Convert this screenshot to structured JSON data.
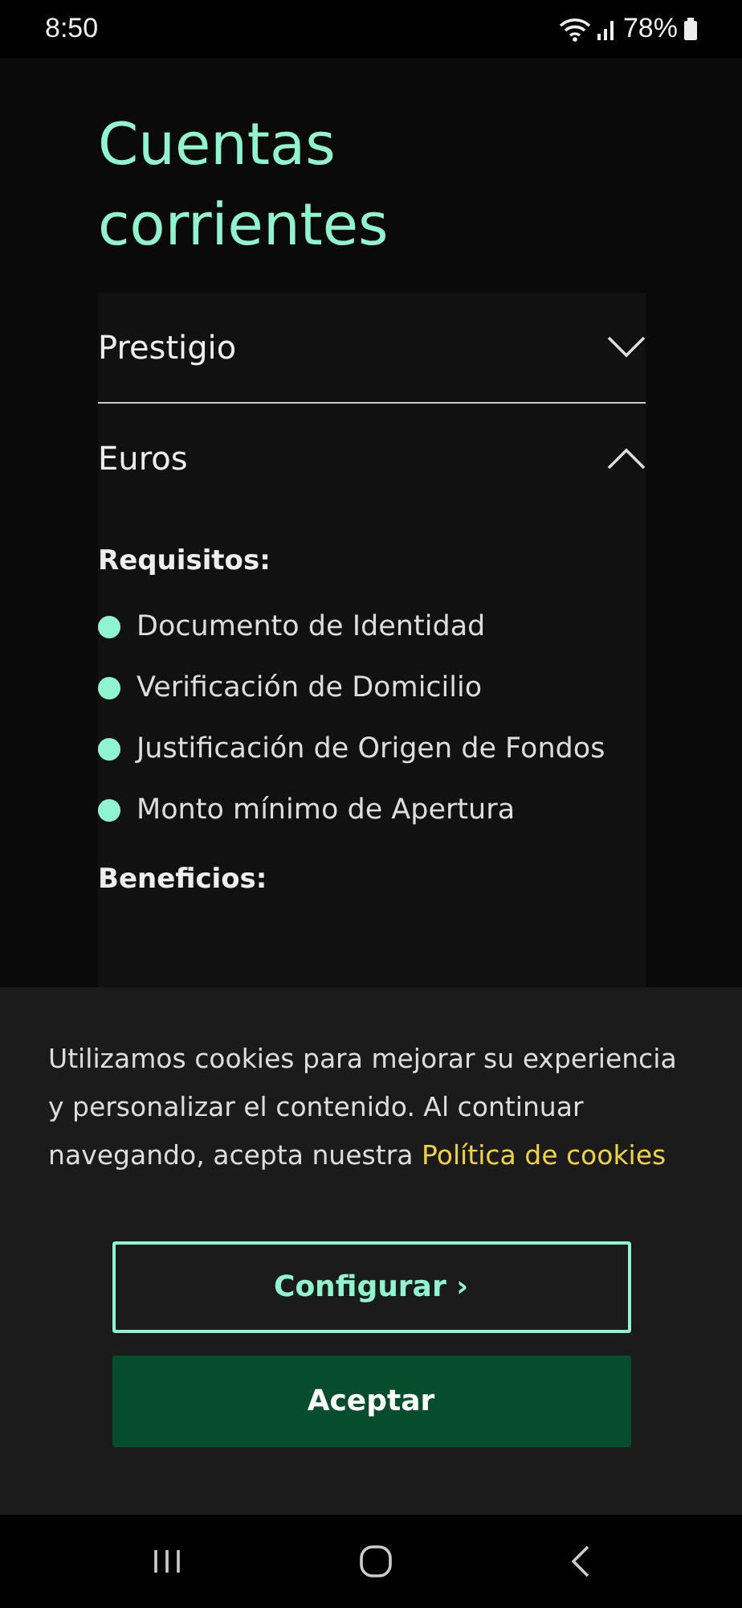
{
  "status_bar": {
    "time": "8:50",
    "battery": "78%"
  },
  "title": "Cuentas corrientes",
  "accordion": [
    {
      "label": "Prestigio",
      "expanded": false
    },
    {
      "label": "Euros",
      "expanded": true,
      "sections": [
        {
          "heading": "Requisitos:",
          "items": [
            "Documento de Identidad",
            "Verificación de Domicilio",
            "Justificación de Origen de Fondos",
            "Monto mínimo de Apertura"
          ]
        },
        {
          "heading": "Beneficios:"
        }
      ]
    }
  ],
  "cookie_banner": {
    "text": "Utilizamos cookies para mejorar su experiencia y personalizar el contenido. Al continuar navegando, acepta nuestra ",
    "link": "Política de cookies",
    "buttons": [
      {
        "label": "Configurar ›",
        "kind": "outline"
      },
      {
        "label": "Aceptar",
        "kind": "primary"
      }
    ]
  }
}
